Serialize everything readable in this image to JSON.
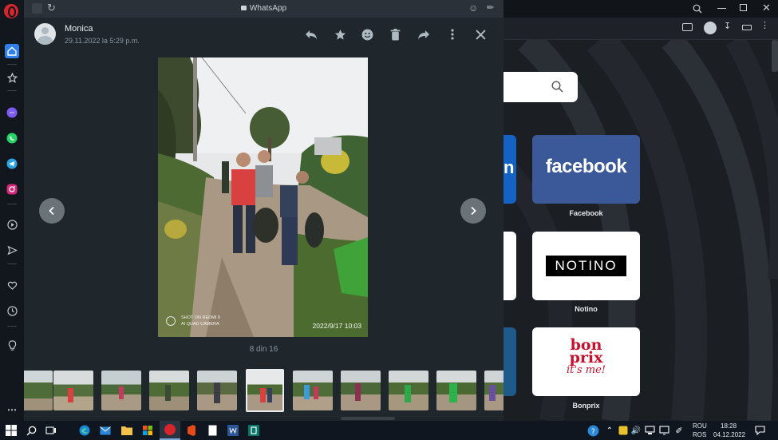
{
  "whatsapp": {
    "window_title": "WhatsApp",
    "contact_name": "Monica",
    "timestamp": "29.11.2022 la 5:29 p.m.",
    "counter": "8 din 16",
    "photo_watermark_line1": "SHOT ON REDMI 9",
    "photo_watermark_line2": "AI QUAD CAMERA",
    "photo_date": "2022/9/17  10:03"
  },
  "speed_dial": {
    "facebook_logo": "facebook",
    "facebook_label": "Facebook",
    "notino_logo": "NOTINO",
    "notino_label": "Notino",
    "bonprix_logo_line1": "bon",
    "bonprix_logo_line2": "prix",
    "bonprix_logo_line3": "it's me!",
    "bonprix_label": "Bonprix"
  },
  "taskbar": {
    "lang_top": "ROU",
    "lang_bottom": "ROS",
    "time": "18:28",
    "date": "04.12.2022"
  },
  "colors": {
    "facebook_blue": "#3b5998",
    "bonprix_red": "#c8102e",
    "opera_red": "#d7262b"
  }
}
